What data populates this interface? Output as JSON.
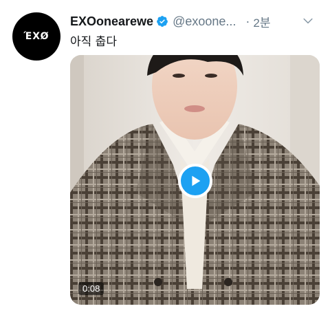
{
  "tweet": {
    "avatar_logo": "ΈXØ",
    "display_name": "EXOonearewe",
    "handle": "@exoone...",
    "separator": "·",
    "time": "2분",
    "text": "아직 춥다",
    "media": {
      "duration": "0:08"
    }
  },
  "colors": {
    "accent": "#1da1f2",
    "secondary_text": "#657786",
    "primary_text": "#14171a"
  },
  "icons": {
    "verified": "verified-badge-icon",
    "caret": "chevron-down-icon",
    "play": "play-icon"
  }
}
